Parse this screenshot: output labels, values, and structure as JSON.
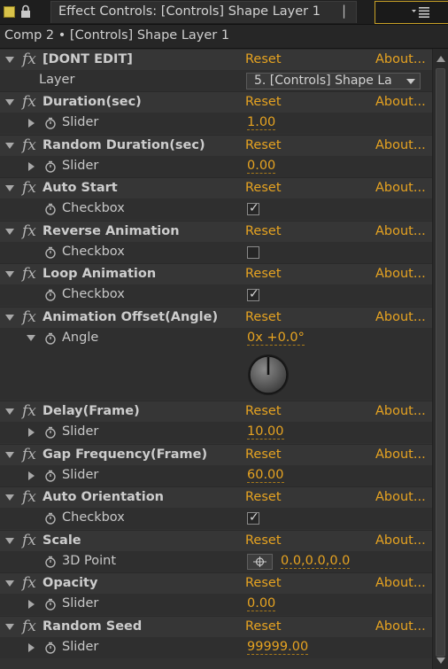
{
  "tab": {
    "title": "Effect Controls: [Controls] Shape Layer 1",
    "close_glyph": "|"
  },
  "breadcrumb": "Comp 2 • [Controls] Shape Layer 1",
  "colors": {
    "accent": "#e6a321",
    "label_swatch": "#d9c34a",
    "panel_highlight": "#c9a227"
  },
  "common": {
    "reset_label": "Reset",
    "about_label": "About..."
  },
  "effects": [
    {
      "name": "[DONT EDIT]",
      "param_label": "Layer",
      "control": "layer-select",
      "value": "5. [Controls] Shape La"
    },
    {
      "name": "Duration(sec)",
      "param_label": "Slider",
      "control": "slider",
      "value": "1.00"
    },
    {
      "name": "Random Duration(sec)",
      "param_label": "Slider",
      "control": "slider",
      "value": "0.00"
    },
    {
      "name": "Auto Start",
      "param_label": "Checkbox",
      "control": "checkbox",
      "checked": true
    },
    {
      "name": "Reverse Animation",
      "param_label": "Checkbox",
      "control": "checkbox",
      "checked": false
    },
    {
      "name": "Loop Animation",
      "param_label": "Checkbox",
      "control": "checkbox",
      "checked": true
    },
    {
      "name": "Animation Offset(Angle)",
      "param_label": "Angle",
      "control": "angle",
      "value": "0x +0.0°"
    },
    {
      "name": "Delay(Frame)",
      "param_label": "Slider",
      "control": "slider",
      "value": "10.00"
    },
    {
      "name": "Gap Frequency(Frame)",
      "param_label": "Slider",
      "control": "slider",
      "value": "60.00"
    },
    {
      "name": "Auto Orientation",
      "param_label": "Checkbox",
      "control": "checkbox",
      "checked": true
    },
    {
      "name": "Scale",
      "param_label": "3D Point",
      "control": "point3d",
      "value": "0.0,0.0,0.0"
    },
    {
      "name": "Opacity",
      "param_label": "Slider",
      "control": "slider",
      "value": "0.00"
    },
    {
      "name": "Random Seed",
      "param_label": "Slider",
      "control": "slider",
      "value": "99999.00"
    }
  ]
}
